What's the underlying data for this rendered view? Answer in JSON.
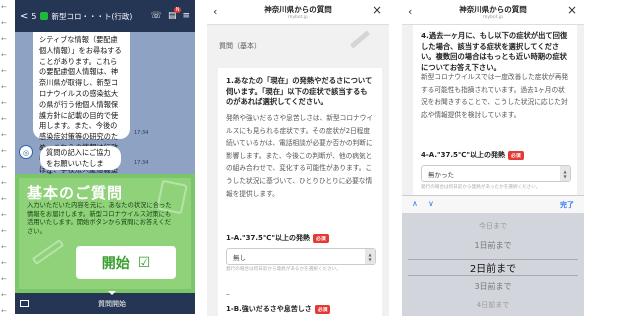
{
  "phone1": {
    "header": {
      "back": "<",
      "count": "5",
      "title": "新型コロ・・・ト(行政)",
      "badge": "N"
    },
    "message1": "シティブな情報（要配慮個人情報）」をお尋ねすることがあります。これらの要配慮個人情報は、神奈川県が取得し、新型コロナウイルスの感染拡大の県が行う他個人情報保護方針に記載の目的で使用します。また、今後の感染症対策等の研究のため、これらの情報は行政機関等、地方自治体等のほか、学校法人慶應義塾に提供されます。",
    "message1_time": "17:34",
    "message2": "質問の記入にご協力をお願いいたします。",
    "message2_time": "17:34",
    "card": {
      "title": "基本のご質問",
      "text": "入力いただいた内容を元に、あなたの状況に合った情報をお届けします。新型コロナウイルス対策にも活用いたします。開始ボタンから質問にお答えください。",
      "button": "開始"
    },
    "menu_label": "質問開始"
  },
  "phone2": {
    "header": {
      "title": "神奈川県からの質問",
      "subtitle": "mybot.jp"
    },
    "section": "質問（基本）",
    "question": "1.あなたの「現在」の発熱やだるさについて伺います。「現在」以下の症状で該当するものがあれば選択してください。",
    "body": "発熱や強いだるさや息苦しさは、新型コロナウイルスにも見られる症状です。その症状が2日程度続いているかは、電話相談が必要か否かの判断に影響します。また、今後この判断が、他の病気との組み合わせで、変化する可能性があります。こうした状況に基づいて、ひとりひとりに必要な情報を提供します。",
    "sub_question1": "1-A.\"37.5℃\"以上の発熱",
    "required": "必須",
    "select_value": "無し",
    "hint": "発行の場合は何日前から発熱があるかを選択ください。",
    "dash": "–",
    "sub_question2": "1-B.強いだるさや息苦しさ"
  },
  "phone3": {
    "header": {
      "title": "神奈川県からの質問",
      "subtitle": "mybot.jp"
    },
    "question": "4.過去一ヶ月に、もし以下の症状が出て回復した場合、該当する症状を選択してください。複数回の場合はもっとも近い時期の症状についてお答え下さい。",
    "body": "新型コロナウイルスでは一度改善した症状が再発する可能性も指摘されています。過去1ヶ月の状況をお聞きすることで、こうした状況に応じた対応や情報提供を検討しています。",
    "sub_question1": "4-A.\"37.5℃\"以上の発熱",
    "required": "必須",
    "select_value": "無かった",
    "hint": "発行の場合は何日前から発熱があったかを選択ください。",
    "toolbar_done": "完了",
    "picker": [
      "今日まで",
      "1日前まで",
      "2日前まで",
      "3日前まで",
      "4日前まで"
    ]
  }
}
